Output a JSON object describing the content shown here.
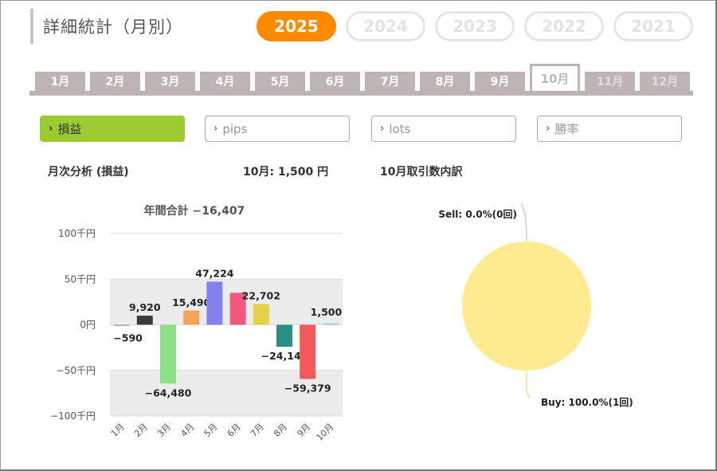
{
  "header": {
    "title": "詳細統計（月別）"
  },
  "years": [
    "2025",
    "2024",
    "2023",
    "2022",
    "2021"
  ],
  "selected_year": "2025",
  "months": [
    "1月",
    "2月",
    "3月",
    "4月",
    "5月",
    "6月",
    "7月",
    "8月",
    "9月",
    "10月",
    "11月",
    "12月"
  ],
  "selected_month": "10月",
  "metrics": [
    "損益",
    "pips",
    "lots",
    "勝率"
  ],
  "selected_metric": "損益",
  "section": {
    "monthly_title": "月次分析 (損益)",
    "month_summary": "10月:  1,500 円",
    "breakdown_title": "10月取引数内訳"
  },
  "chart_data": [
    {
      "type": "bar",
      "title": "年間合計 −16,407",
      "categories": [
        "1月",
        "2月",
        "3月",
        "4月",
        "5月",
        "6月",
        "7月",
        "8月",
        "9月",
        "10月"
      ],
      "values": [
        -590,
        9920,
        -64480,
        15490,
        47224,
        35000,
        22702,
        -24140,
        -59379,
        1500
      ],
      "data_labels": [
        "−590",
        "9,920",
        "−64,480",
        "15,490",
        "47,224",
        "",
        "22,702",
        "−24,140",
        "−59,379",
        "1,500"
      ],
      "colors": [
        "#aaaaaa",
        "#3a3a3a",
        "#8ee087",
        "#f7a25b",
        "#8282ee",
        "#f0587e",
        "#e6d14b",
        "#2a9085",
        "#f05a5a",
        "#8fd4f0"
      ],
      "ylim": [
        -100000,
        100000
      ],
      "yticks": [
        100000,
        50000,
        0,
        -50000,
        -100000
      ],
      "ytick_labels": [
        "100千円",
        "50千円",
        "0円",
        "−50千円",
        "−100千円"
      ],
      "grid": true
    },
    {
      "type": "pie",
      "labels": [
        "Sell: 0.0%(0回)",
        "Buy: 100.0%(1回)"
      ],
      "values": [
        0,
        1
      ],
      "colors": [
        "#9fe09f",
        "#fcec8f"
      ]
    }
  ]
}
